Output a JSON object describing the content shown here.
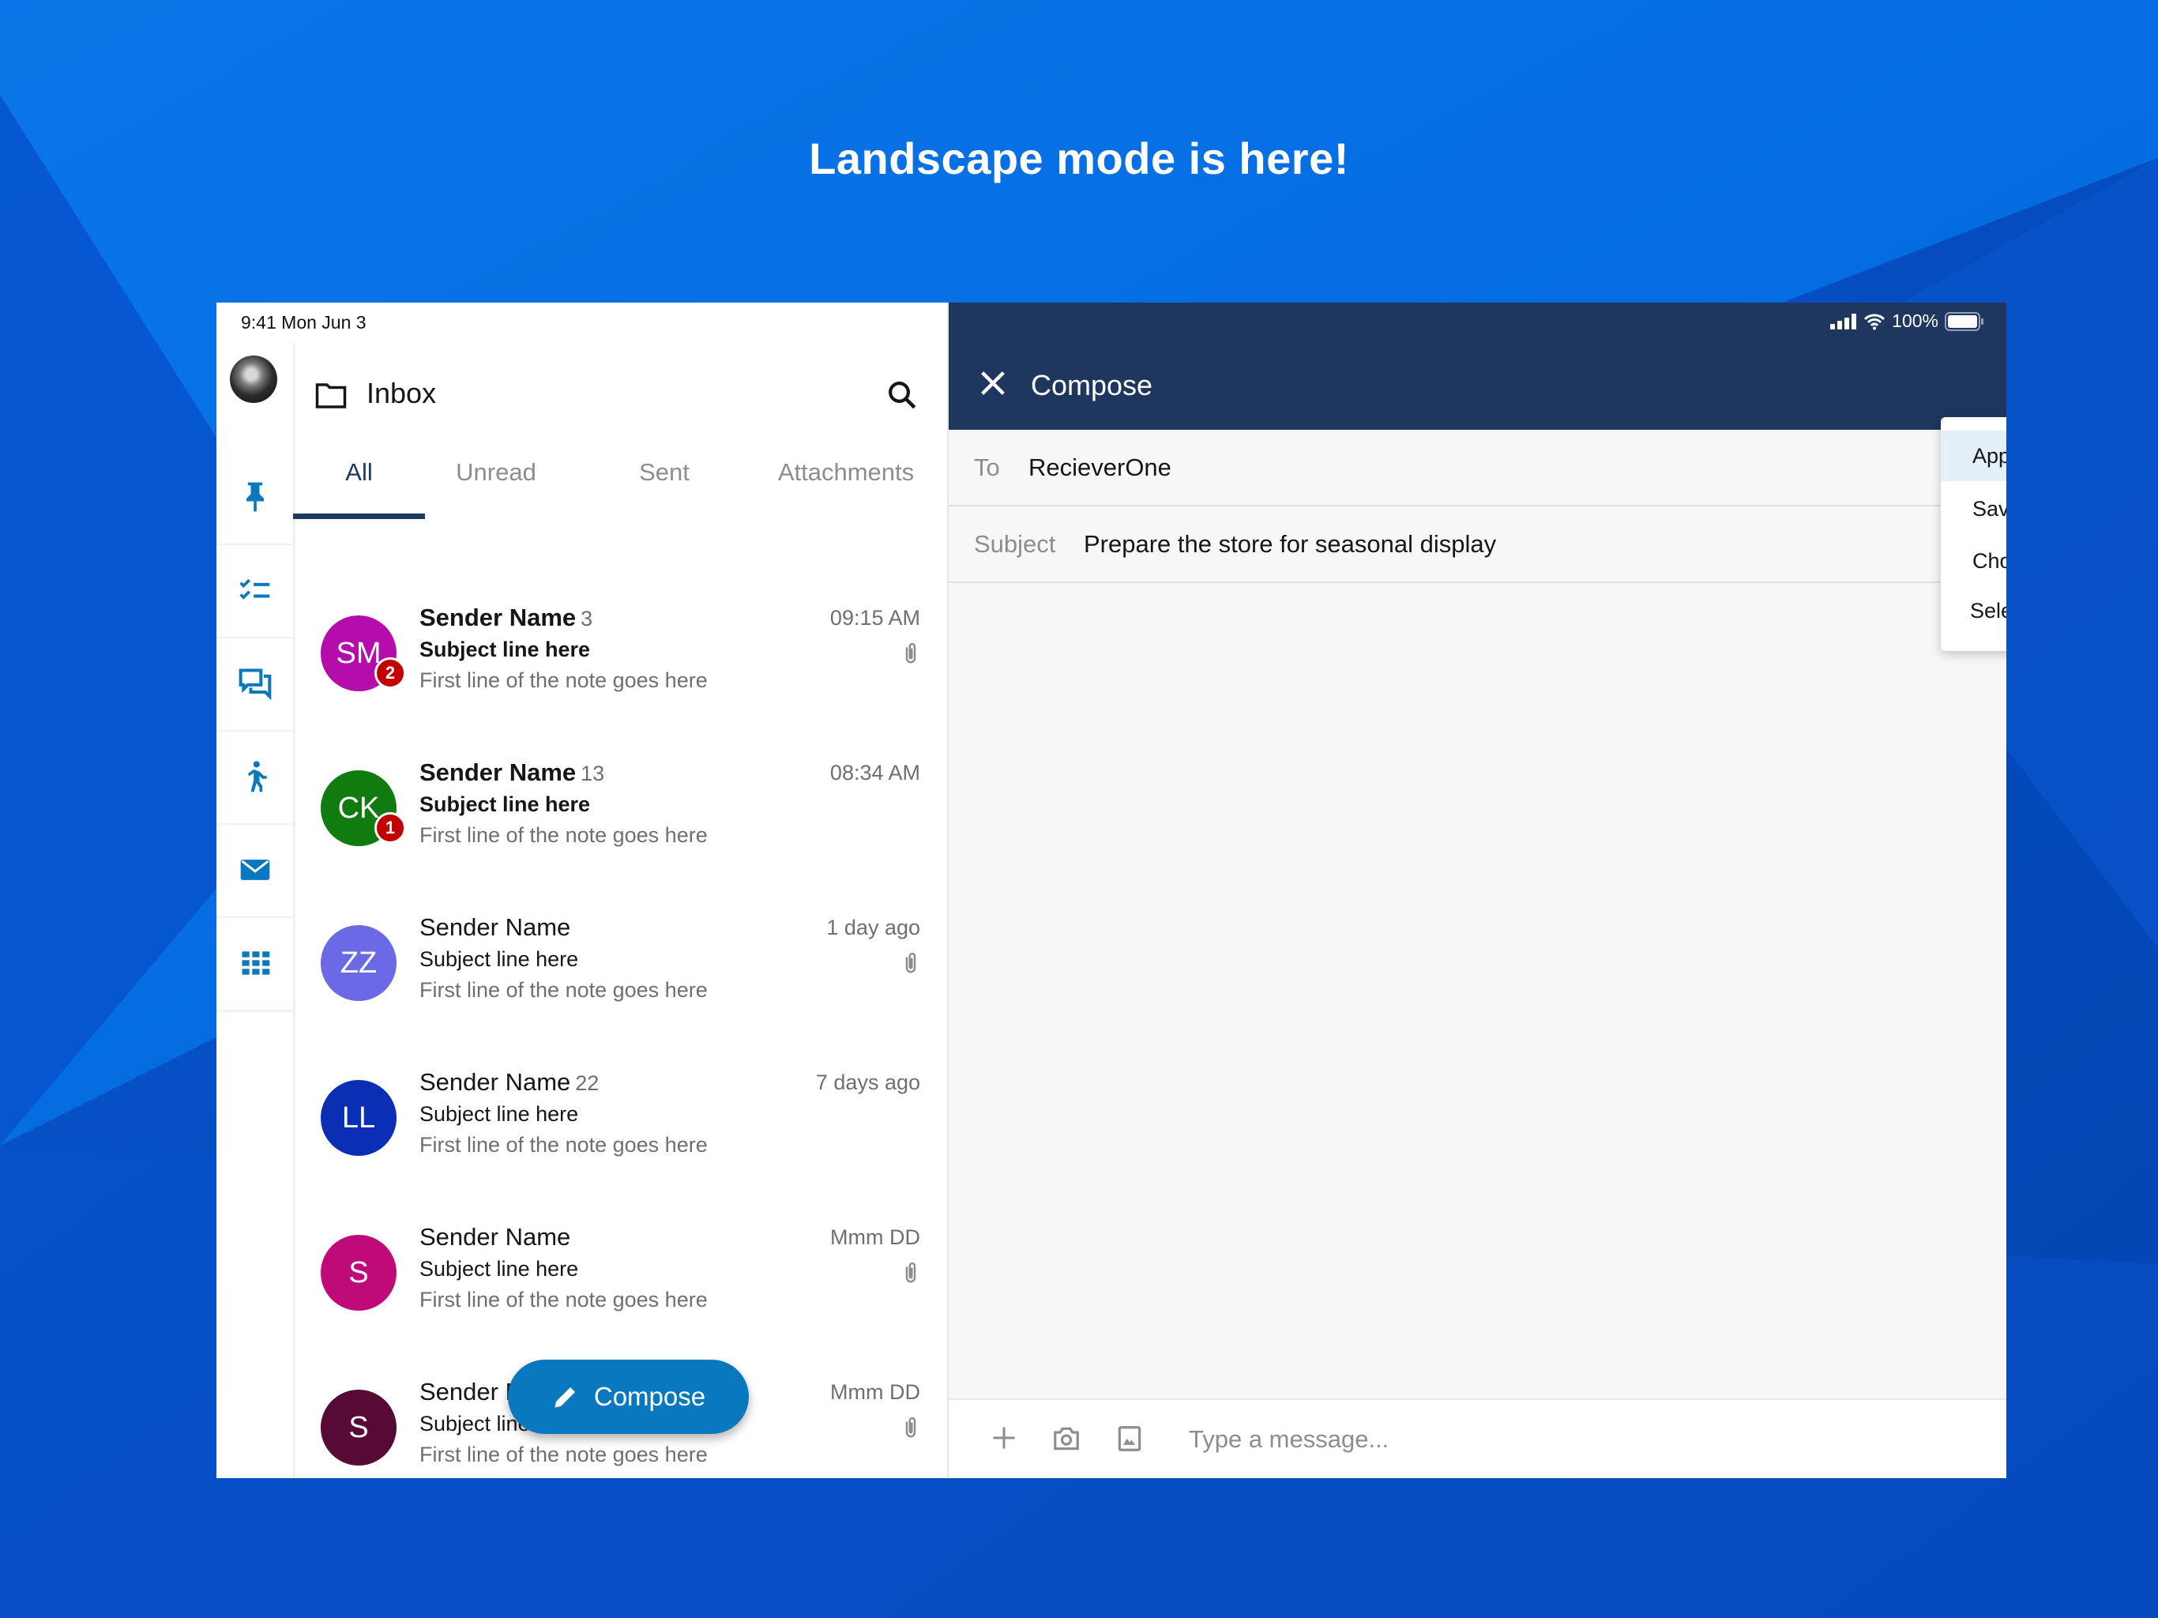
{
  "headline": "Landscape mode is here!",
  "colors": {
    "background": "#0a5fd8",
    "header_navy": "#1f375e",
    "accent": "#0a78be",
    "unread_badge": "#c30000",
    "menu_highlight": "#e5eff8"
  },
  "status_bar": {
    "time": "9:41",
    "date": "Mon Jun 3",
    "time_date": "9:41 Mon Jun 3",
    "battery": "100%",
    "battery_level": 1.0
  },
  "sidebar": {
    "items": [
      {
        "icon": "pin-icon",
        "label": "Pinned"
      },
      {
        "icon": "checklist-icon",
        "label": "Tasks"
      },
      {
        "icon": "chat-icon",
        "label": "Conversations"
      },
      {
        "icon": "walking-person-icon",
        "label": "Activity"
      },
      {
        "icon": "mail-icon",
        "label": "Mail"
      },
      {
        "icon": "apps-grid-icon",
        "label": "Apps"
      }
    ]
  },
  "inbox": {
    "title": "Inbox",
    "tabs": [
      {
        "label": "All",
        "active": true
      },
      {
        "label": "Unread",
        "active": false
      },
      {
        "label": "Sent",
        "active": false
      },
      {
        "label": "Attachments",
        "active": false
      }
    ],
    "messages": [
      {
        "initials": "SM",
        "color": "#b40dab",
        "sender": "Sender Name",
        "count": "3",
        "subject": "Subject line here",
        "preview": "First line of the note goes here",
        "time": "09:15 AM",
        "unread": true,
        "badge": "2",
        "attachment": true
      },
      {
        "initials": "CK",
        "color": "#107c10",
        "sender": "Sender Name",
        "count": "13",
        "subject": "Subject line here",
        "preview": "First line of the note goes here",
        "time": "08:34 AM",
        "unread": true,
        "badge": "1",
        "attachment": false
      },
      {
        "initials": "ZZ",
        "color": "#6b69e6",
        "sender": "Sender Name",
        "count": "",
        "subject": "Subject line here",
        "preview": "First line of the note goes here",
        "time": "1 day ago",
        "unread": false,
        "badge": "",
        "attachment": true
      },
      {
        "initials": "LL",
        "color": "#0a2fb5",
        "sender": "Sender Name",
        "count": "22",
        "subject": "Subject line here",
        "preview": "First line of the note goes here",
        "time": "7 days ago",
        "unread": false,
        "badge": "",
        "attachment": false
      },
      {
        "initials": "S",
        "color": "#bf0a77",
        "sender": "Sender Name",
        "count": "",
        "subject": "Subject line here",
        "preview": "First line of the note goes here",
        "time": "Mmm DD",
        "unread": false,
        "badge": "",
        "attachment": true
      },
      {
        "initials": "S",
        "color": "#560a35",
        "sender": "Sender Name",
        "count": "",
        "subject": "Subject line here",
        "preview": "First line of the note goes here",
        "time": "Mmm DD",
        "unread": false,
        "badge": "",
        "attachment": true
      }
    ],
    "compose_button": "Compose"
  },
  "compose": {
    "title": "Compose",
    "to_label": "To",
    "to_value": "RecieverOne",
    "subject_label": "Subject",
    "subject_value": "Prepare the store for seasonal display",
    "message_placeholder": "Type a message...",
    "menu": [
      {
        "label": "Apply Template",
        "highlighted": true
      },
      {
        "label": "Save as Template",
        "highlighted": false
      },
      {
        "label": "Choose Recipients",
        "highlighted": false
      },
      {
        "label": "Select Groups",
        "highlighted": false
      }
    ]
  }
}
